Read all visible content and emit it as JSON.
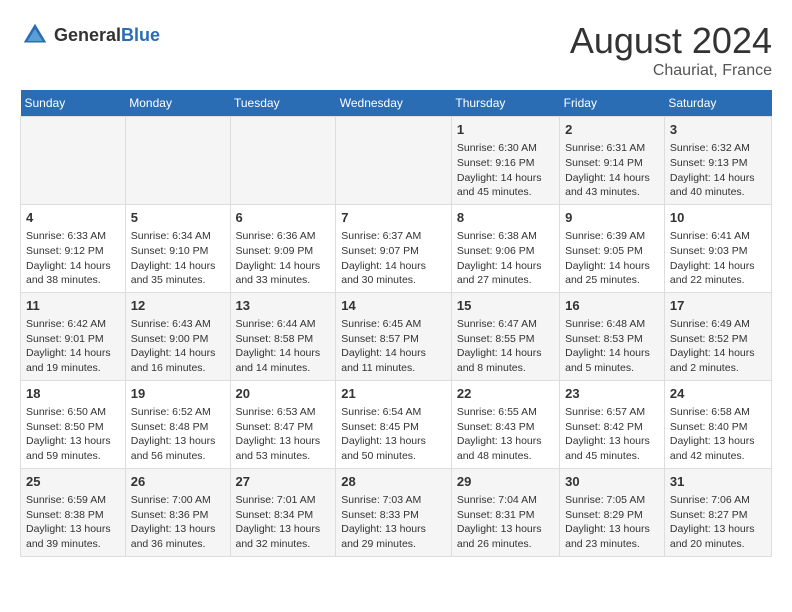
{
  "header": {
    "logo_general": "General",
    "logo_blue": "Blue",
    "title": "August 2024",
    "subtitle": "Chauriat, France"
  },
  "days_of_week": [
    "Sunday",
    "Monday",
    "Tuesday",
    "Wednesday",
    "Thursday",
    "Friday",
    "Saturday"
  ],
  "weeks": [
    [
      {
        "day": "",
        "data": ""
      },
      {
        "day": "",
        "data": ""
      },
      {
        "day": "",
        "data": ""
      },
      {
        "day": "",
        "data": ""
      },
      {
        "day": "1",
        "data": "Sunrise: 6:30 AM\nSunset: 9:16 PM\nDaylight: 14 hours and 45 minutes."
      },
      {
        "day": "2",
        "data": "Sunrise: 6:31 AM\nSunset: 9:14 PM\nDaylight: 14 hours and 43 minutes."
      },
      {
        "day": "3",
        "data": "Sunrise: 6:32 AM\nSunset: 9:13 PM\nDaylight: 14 hours and 40 minutes."
      }
    ],
    [
      {
        "day": "4",
        "data": "Sunrise: 6:33 AM\nSunset: 9:12 PM\nDaylight: 14 hours and 38 minutes."
      },
      {
        "day": "5",
        "data": "Sunrise: 6:34 AM\nSunset: 9:10 PM\nDaylight: 14 hours and 35 minutes."
      },
      {
        "day": "6",
        "data": "Sunrise: 6:36 AM\nSunset: 9:09 PM\nDaylight: 14 hours and 33 minutes."
      },
      {
        "day": "7",
        "data": "Sunrise: 6:37 AM\nSunset: 9:07 PM\nDaylight: 14 hours and 30 minutes."
      },
      {
        "day": "8",
        "data": "Sunrise: 6:38 AM\nSunset: 9:06 PM\nDaylight: 14 hours and 27 minutes."
      },
      {
        "day": "9",
        "data": "Sunrise: 6:39 AM\nSunset: 9:05 PM\nDaylight: 14 hours and 25 minutes."
      },
      {
        "day": "10",
        "data": "Sunrise: 6:41 AM\nSunset: 9:03 PM\nDaylight: 14 hours and 22 minutes."
      }
    ],
    [
      {
        "day": "11",
        "data": "Sunrise: 6:42 AM\nSunset: 9:01 PM\nDaylight: 14 hours and 19 minutes."
      },
      {
        "day": "12",
        "data": "Sunrise: 6:43 AM\nSunset: 9:00 PM\nDaylight: 14 hours and 16 minutes."
      },
      {
        "day": "13",
        "data": "Sunrise: 6:44 AM\nSunset: 8:58 PM\nDaylight: 14 hours and 14 minutes."
      },
      {
        "day": "14",
        "data": "Sunrise: 6:45 AM\nSunset: 8:57 PM\nDaylight: 14 hours and 11 minutes."
      },
      {
        "day": "15",
        "data": "Sunrise: 6:47 AM\nSunset: 8:55 PM\nDaylight: 14 hours and 8 minutes."
      },
      {
        "day": "16",
        "data": "Sunrise: 6:48 AM\nSunset: 8:53 PM\nDaylight: 14 hours and 5 minutes."
      },
      {
        "day": "17",
        "data": "Sunrise: 6:49 AM\nSunset: 8:52 PM\nDaylight: 14 hours and 2 minutes."
      }
    ],
    [
      {
        "day": "18",
        "data": "Sunrise: 6:50 AM\nSunset: 8:50 PM\nDaylight: 13 hours and 59 minutes."
      },
      {
        "day": "19",
        "data": "Sunrise: 6:52 AM\nSunset: 8:48 PM\nDaylight: 13 hours and 56 minutes."
      },
      {
        "day": "20",
        "data": "Sunrise: 6:53 AM\nSunset: 8:47 PM\nDaylight: 13 hours and 53 minutes."
      },
      {
        "day": "21",
        "data": "Sunrise: 6:54 AM\nSunset: 8:45 PM\nDaylight: 13 hours and 50 minutes."
      },
      {
        "day": "22",
        "data": "Sunrise: 6:55 AM\nSunset: 8:43 PM\nDaylight: 13 hours and 48 minutes."
      },
      {
        "day": "23",
        "data": "Sunrise: 6:57 AM\nSunset: 8:42 PM\nDaylight: 13 hours and 45 minutes."
      },
      {
        "day": "24",
        "data": "Sunrise: 6:58 AM\nSunset: 8:40 PM\nDaylight: 13 hours and 42 minutes."
      }
    ],
    [
      {
        "day": "25",
        "data": "Sunrise: 6:59 AM\nSunset: 8:38 PM\nDaylight: 13 hours and 39 minutes."
      },
      {
        "day": "26",
        "data": "Sunrise: 7:00 AM\nSunset: 8:36 PM\nDaylight: 13 hours and 36 minutes."
      },
      {
        "day": "27",
        "data": "Sunrise: 7:01 AM\nSunset: 8:34 PM\nDaylight: 13 hours and 32 minutes."
      },
      {
        "day": "28",
        "data": "Sunrise: 7:03 AM\nSunset: 8:33 PM\nDaylight: 13 hours and 29 minutes."
      },
      {
        "day": "29",
        "data": "Sunrise: 7:04 AM\nSunset: 8:31 PM\nDaylight: 13 hours and 26 minutes."
      },
      {
        "day": "30",
        "data": "Sunrise: 7:05 AM\nSunset: 8:29 PM\nDaylight: 13 hours and 23 minutes."
      },
      {
        "day": "31",
        "data": "Sunrise: 7:06 AM\nSunset: 8:27 PM\nDaylight: 13 hours and 20 minutes."
      }
    ]
  ]
}
